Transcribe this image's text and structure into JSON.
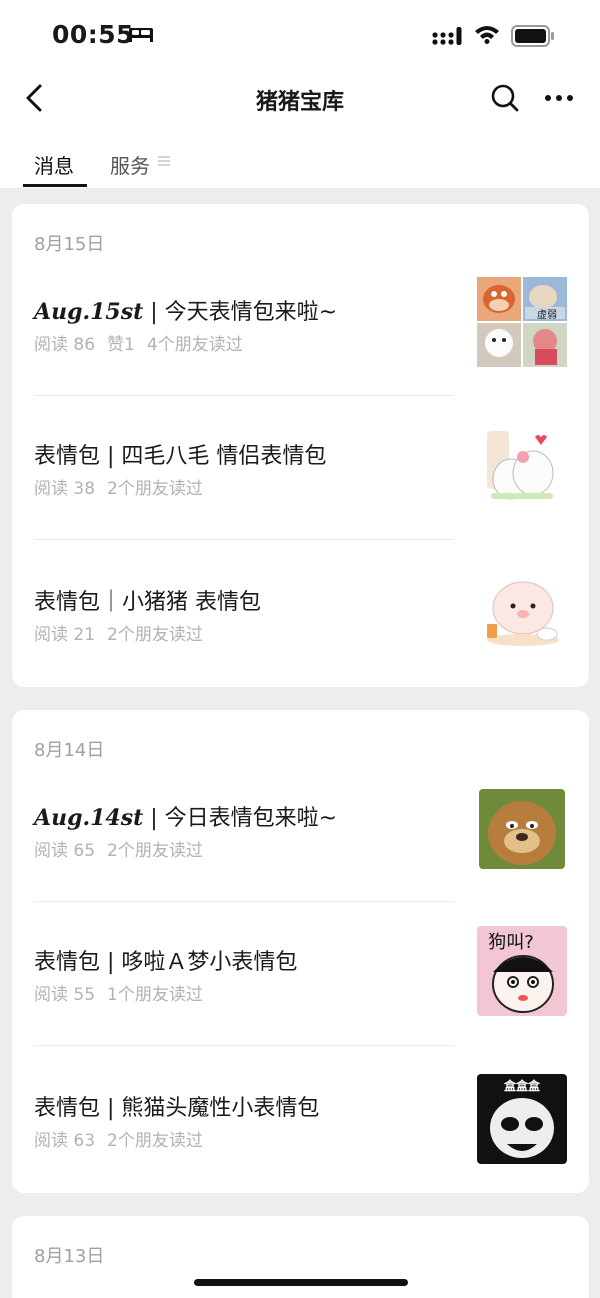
{
  "status": {
    "time": "00:55"
  },
  "nav": {
    "title": "猪猪宝库"
  },
  "tabs": [
    {
      "label": "消息",
      "active": true
    },
    {
      "label": "服务",
      "active": false
    }
  ],
  "groups": [
    {
      "date": "8月15日",
      "items": [
        {
          "prefix": "Aug.15st",
          "title": " | 今天表情包来啦~",
          "reads": "阅读 86",
          "likes": "赞1",
          "friends": "4个朋友读过"
        },
        {
          "prefix": "",
          "title": "表情包 | 四毛八毛 情侣表情包",
          "reads": "阅读 38",
          "likes": "",
          "friends": "2个朋友读过"
        },
        {
          "prefix": "",
          "title": "表情包｜小猪猪 表情包",
          "reads": "阅读 21",
          "likes": "",
          "friends": "2个朋友读过"
        }
      ]
    },
    {
      "date": "8月14日",
      "items": [
        {
          "prefix": "Aug.14st",
          "title": " | 今日表情包来啦~",
          "reads": "阅读 65",
          "likes": "",
          "friends": "2个朋友读过"
        },
        {
          "prefix": "",
          "title": "表情包 | 哆啦Ａ梦小表情包",
          "reads": "阅读 55",
          "likes": "",
          "friends": "1个朋友读过",
          "thumb_text": "狗叫?"
        },
        {
          "prefix": "",
          "title": "表情包 |  熊猫头魔性小表情包",
          "reads": "阅读 63",
          "likes": "",
          "friends": "2个朋友读过",
          "thumb_text": "盒盒盒"
        }
      ]
    },
    {
      "date": "8月13日",
      "items": []
    }
  ],
  "thumb_labels": {
    "weak": "虚弱"
  },
  "colors": {
    "accent": "#111111",
    "meta": "#b2b2b2",
    "background": "#ededed"
  }
}
